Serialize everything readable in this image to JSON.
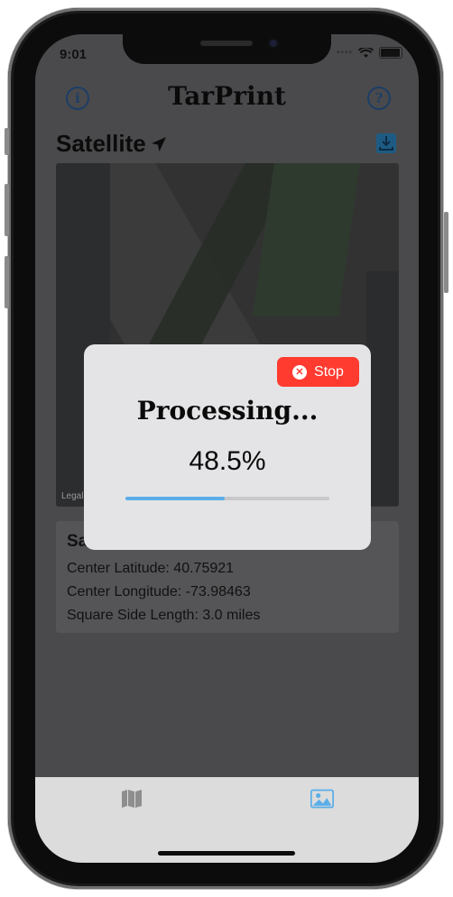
{
  "status_bar": {
    "time": "9:01"
  },
  "header": {
    "title": "TarPrint"
  },
  "section": {
    "title": "Satellite"
  },
  "map": {
    "legal": "Legal"
  },
  "info_card": {
    "title": "Sa",
    "center_latitude": "Center Latitude: 40.75921",
    "center_longitude": "Center Longitude: -73.98463",
    "square_side": "Square Side Length: 3.0 miles"
  },
  "processing_dialog": {
    "stop_label": "Stop",
    "title": "Processing...",
    "percent_text": "48.5%",
    "progress": 0.485
  },
  "tab_bar": {
    "tabs": [
      {
        "icon": "map-icon"
      },
      {
        "icon": "image-icon",
        "selected": true
      }
    ]
  },
  "colors": {
    "accent": "#5aaee8",
    "stop": "#ff3b30",
    "nav_icon": "#1c3e66"
  }
}
